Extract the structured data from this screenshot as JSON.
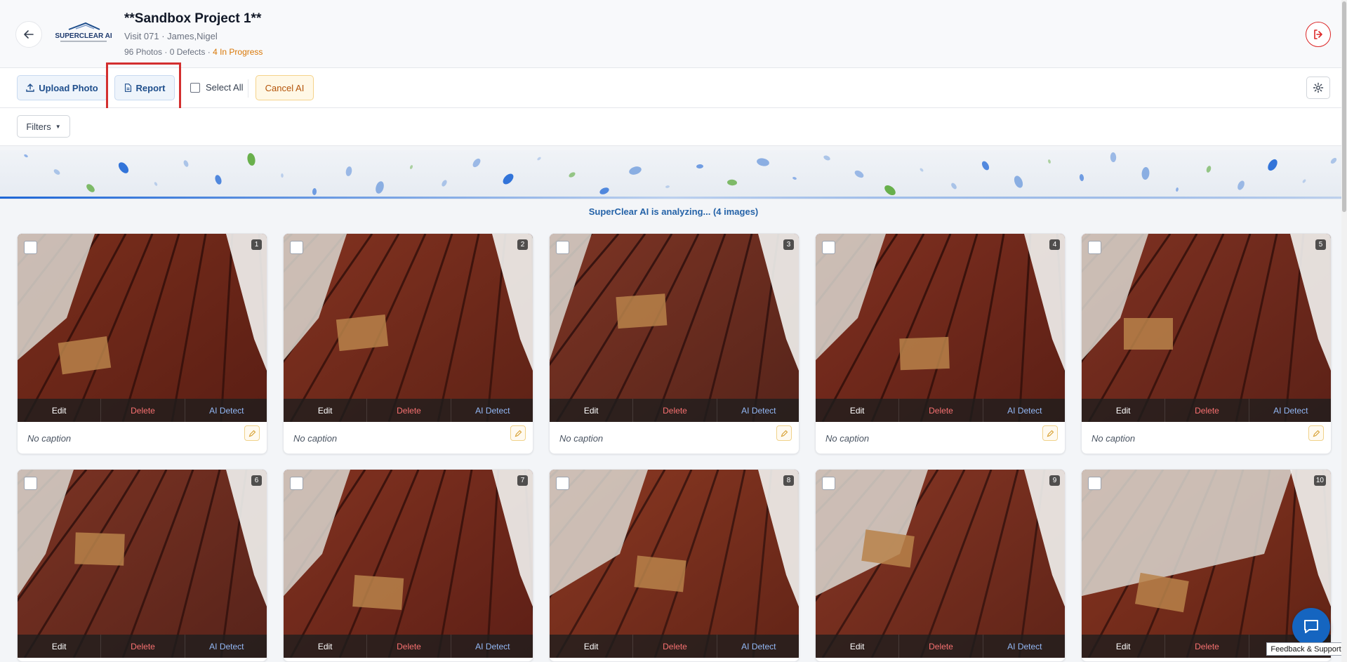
{
  "header": {
    "logo_text": "SUPERCLEAR AI",
    "project_title": "**Sandbox Project 1**",
    "visit_info": "Visit 071 · James,Nigel",
    "stats_prefix": "96 Photos · 0 Defects · ",
    "stats_progress": "4 In Progress"
  },
  "toolbar": {
    "upload_label": "Upload Photo",
    "report_label": "Report",
    "select_all_label": "Select All",
    "cancel_ai_label": "Cancel AI"
  },
  "filters": {
    "label": "Filters"
  },
  "banner": {
    "analyzing_text": "SuperClear AI is analyzing... (4 images)"
  },
  "photos": [
    {
      "number": "1",
      "edit": "Edit",
      "delete": "Delete",
      "ai_detect": "AI Detect",
      "caption": "No caption"
    },
    {
      "number": "2",
      "edit": "Edit",
      "delete": "Delete",
      "ai_detect": "AI Detect",
      "caption": "No caption"
    },
    {
      "number": "3",
      "edit": "Edit",
      "delete": "Delete",
      "ai_detect": "AI Detect",
      "caption": "No caption"
    },
    {
      "number": "4",
      "edit": "Edit",
      "delete": "Delete",
      "ai_detect": "AI Detect",
      "caption": "No caption"
    },
    {
      "number": "5",
      "edit": "Edit",
      "delete": "Delete",
      "ai_detect": "AI Detect",
      "caption": "No caption"
    },
    {
      "number": "6",
      "edit": "Edit",
      "delete": "Delete",
      "ai_detect": "AI Detect"
    },
    {
      "number": "7",
      "edit": "Edit",
      "delete": "Delete",
      "ai_detect": "AI Detect"
    },
    {
      "number": "8",
      "edit": "Edit",
      "delete": "Delete",
      "ai_detect": "AI Detect"
    },
    {
      "number": "9",
      "edit": "Edit",
      "delete": "Delete",
      "ai_detect": "AI Detect"
    },
    {
      "number": "10",
      "edit": "Edit",
      "delete": "Delete",
      "ai_detect": "AI Detect"
    }
  ],
  "support": {
    "feedback_label": "Feedback & Support"
  },
  "colors": {
    "brand_blue": "#1e4e8c",
    "progress_amber": "#d97706",
    "delete_red": "#f87171",
    "highlight_red": "#d32f2f"
  }
}
